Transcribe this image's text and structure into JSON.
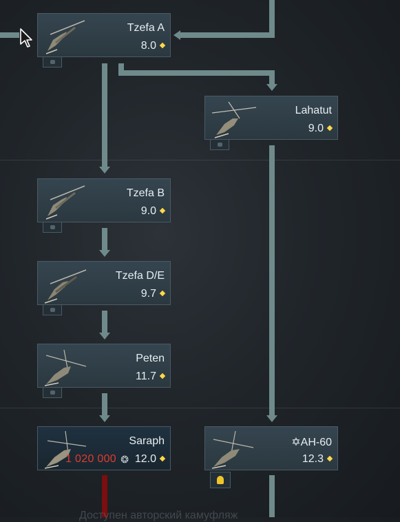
{
  "cards": {
    "tzefa_a": {
      "name": "Tzefa A",
      "br": "8.0"
    },
    "tzefa_b": {
      "name": "Tzefa B",
      "br": "9.0"
    },
    "tzefa_de": {
      "name": "Tzefa D/E",
      "br": "9.7"
    },
    "peten": {
      "name": "Peten",
      "br": "11.7"
    },
    "saraph": {
      "name": "Saraph",
      "br": "12.0",
      "cost": "1 020 000"
    },
    "lahatut": {
      "name": "Lahatut",
      "br": "9.0"
    },
    "ah60": {
      "name": "✡AH-60",
      "br": "12.3"
    }
  },
  "faded_text": "Доступен авторский камуфляж",
  "colors": {
    "connector": "#6f8a8b",
    "br_diamond": "#ffd84a",
    "cost": "#e23a2e",
    "premium_tag": "#f0c52a"
  }
}
